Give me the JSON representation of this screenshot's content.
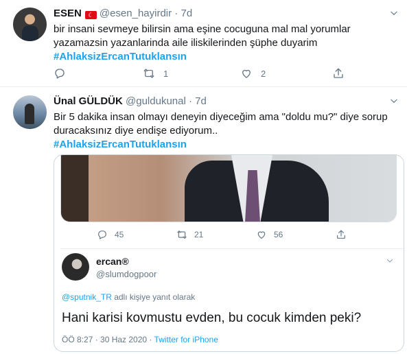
{
  "tweets": [
    {
      "author_name": "ESEN",
      "flag_label": "TR",
      "handle": "@esen_hayirdir",
      "separator": "·",
      "time": "7d",
      "text_line1": "bir insani sevmeye bilirsin ama eşine cocuguna mal mal yorumlar",
      "text_line2": "yazamazsin yazanlarinda aile iliskilerinden şüphe duyarim",
      "hashtag": "#AhlaksizErcanTutuklansın",
      "reply_count": "",
      "retweet_count": "1",
      "like_count": "2"
    },
    {
      "author_name": "Ünal GÜLDÜK",
      "handle": "@guldukunal",
      "separator": "·",
      "time": "7d",
      "text_line1": "Bir 5 dakika insan olmayı deneyin diyeceğim ama \"doldu mu?\" diye sorup",
      "text_line2": "duracaksınız diye endişe ediyorum..",
      "hashtag": "#AhlaksizErcanTutuklansın"
    }
  ],
  "quoted": {
    "reply_count": "45",
    "retweet_count": "21",
    "like_count": "56",
    "author_name": "ercan®",
    "handle": "@slumdogpoor",
    "replying_mention": "@sputnik_TR",
    "replying_suffix": " adlı kişiye yanıt olarak",
    "text": "Hani karisi kovmustu evden, bu cocuk kimden peki?",
    "timestamp": "ÖÖ 8:27 · 30 Haz 2020 · ",
    "source": "Twitter for iPhone"
  },
  "colors": {
    "accent": "#1da1f2",
    "muted": "#657786",
    "text": "#14171a",
    "border": "#e6ecf0"
  },
  "icons": [
    "reply-icon",
    "retweet-icon",
    "like-icon",
    "share-icon",
    "chevron-down-icon",
    "turkey-flag-icon"
  ]
}
